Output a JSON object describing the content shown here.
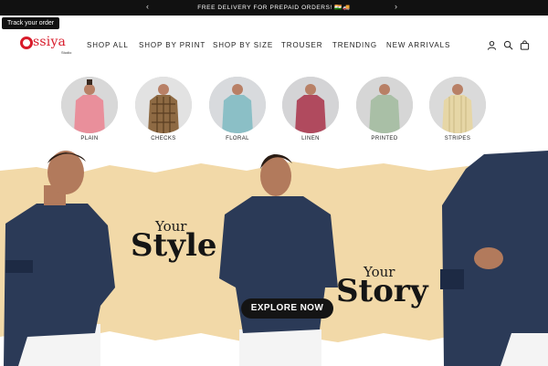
{
  "announcement": {
    "text": "FREE DELIVERY FOR PREPAID ORDERS! 🇮🇳🚚",
    "prev_arrow": "‹",
    "next_arrow": "›"
  },
  "track_order": "Track your order",
  "brand": {
    "name": "ssiya",
    "sub": "Studio",
    "color": "#d81b2a"
  },
  "nav": [
    "SHOP ALL",
    "SHOP BY PRINT",
    "SHOP BY SIZE",
    "TROUSER",
    "TRENDING",
    "NEW ARRIVALS"
  ],
  "header_icons": [
    "user-icon",
    "search-icon",
    "bag-icon"
  ],
  "categories": [
    {
      "label": "PLAIN",
      "shirt": "#e98f9b"
    },
    {
      "label": "CHECKS",
      "shirt": "#8e6a43"
    },
    {
      "label": "FLORAL",
      "shirt": "#8bbfc6"
    },
    {
      "label": "LINEN",
      "shirt": "#b04a5e"
    },
    {
      "label": "PRINTED",
      "shirt": "#a9bfa6"
    },
    {
      "label": "STRIPES",
      "shirt": "#e6d6a6"
    }
  ],
  "hero": {
    "line1_small": "Your",
    "line1_big": "Style",
    "line2_small": "Your",
    "line2_big": "Story",
    "cta": "EXPLORE NOW",
    "paper_color": "#f2d9a8",
    "shirt_color": "#2b3a57"
  }
}
